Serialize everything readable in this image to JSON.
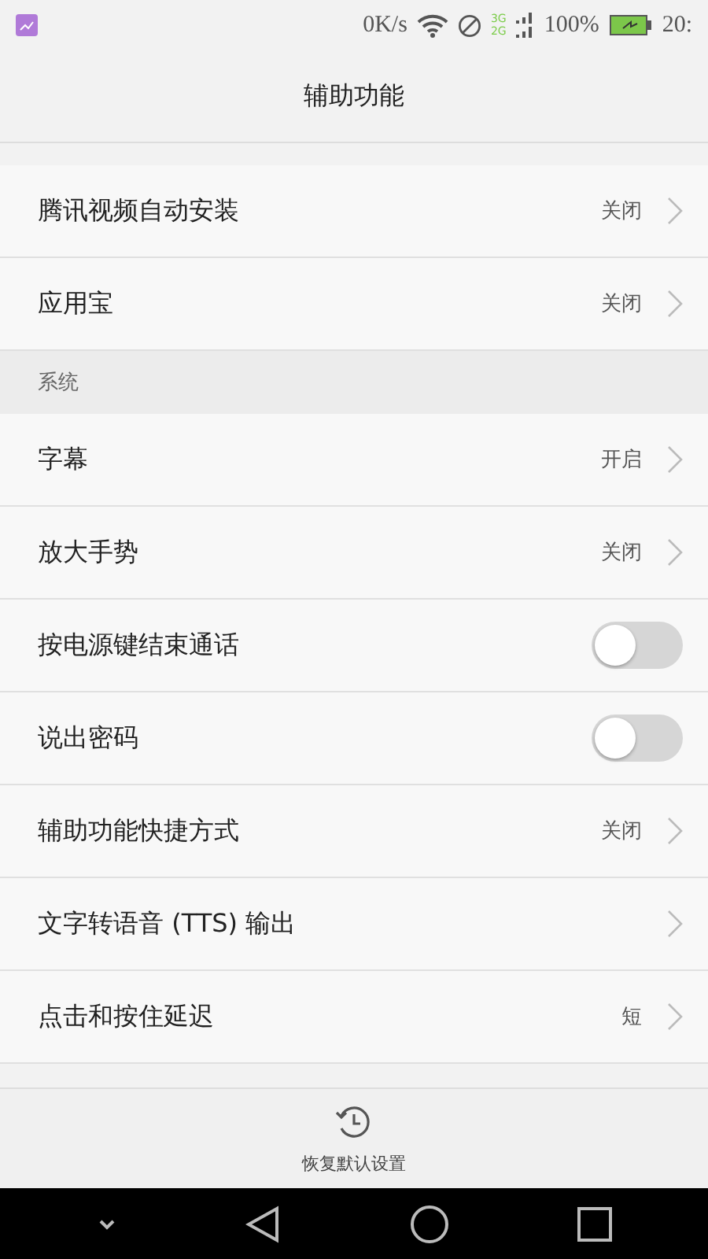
{
  "status_bar": {
    "speed": "0K/s",
    "network_top": "3G",
    "network_bottom": "2G",
    "battery": "100%",
    "time": "20:"
  },
  "title": "辅助功能",
  "sections": [
    {
      "items": [
        {
          "kind": "value",
          "label": "腾讯视频自动安装",
          "value": "关闭"
        },
        {
          "kind": "value",
          "label": "应用宝",
          "value": "关闭"
        }
      ]
    },
    {
      "header": "系统",
      "items": [
        {
          "kind": "value",
          "label": "字幕",
          "value": "开启"
        },
        {
          "kind": "value",
          "label": "放大手势",
          "value": "关闭"
        },
        {
          "kind": "switch",
          "label": "按电源键结束通话",
          "on": false
        },
        {
          "kind": "switch",
          "label": "说出密码",
          "on": false
        },
        {
          "kind": "value",
          "label": "辅助功能快捷方式",
          "value": "关闭"
        },
        {
          "kind": "link",
          "label": "文字转语音 (TTS) 输出"
        },
        {
          "kind": "value",
          "label": "点击和按住延迟",
          "value": "短"
        }
      ]
    }
  ],
  "bottom_action": "恢复默认设置"
}
